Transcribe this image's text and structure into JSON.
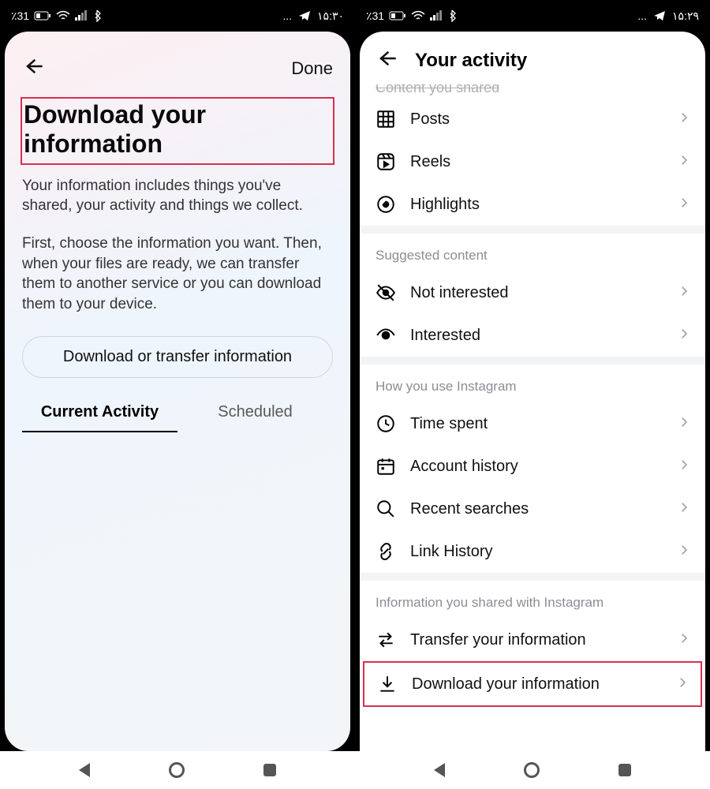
{
  "status": {
    "battery": "٪31",
    "dots": "...",
    "time_left": "۱۵:۳۰",
    "time_right": "۱۵:۲۹"
  },
  "left": {
    "done": "Done",
    "title": "Download your information",
    "para1": "Your information includes things you've shared, your activity and things we collect.",
    "para2": "First, choose the information you want. Then, when your files are ready, we can transfer them to another service or you can download them to your device.",
    "button": "Download or transfer information",
    "tab_current": "Current Activity",
    "tab_scheduled": "Scheduled"
  },
  "right": {
    "header": "Your activity",
    "cut": "Content you shared",
    "rows1": [
      {
        "label": "Posts",
        "icon": "grid-icon"
      },
      {
        "label": "Reels",
        "icon": "reels-icon"
      },
      {
        "label": "Highlights",
        "icon": "highlights-icon"
      }
    ],
    "sec2": "Suggested content",
    "rows2": [
      {
        "label": "Not interested",
        "icon": "eye-slash-icon"
      },
      {
        "label": "Interested",
        "icon": "eye-icon"
      }
    ],
    "sec3": "How you use Instagram",
    "rows3": [
      {
        "label": "Time spent",
        "icon": "clock-icon"
      },
      {
        "label": "Account history",
        "icon": "calendar-icon"
      },
      {
        "label": "Recent searches",
        "icon": "search-icon"
      },
      {
        "label": "Link History",
        "icon": "link-icon"
      }
    ],
    "sec4": "Information you shared with Instagram",
    "rows4": [
      {
        "label": "Transfer your information",
        "icon": "transfer-icon"
      },
      {
        "label": "Download your information",
        "icon": "download-icon",
        "highlight": true
      }
    ]
  }
}
